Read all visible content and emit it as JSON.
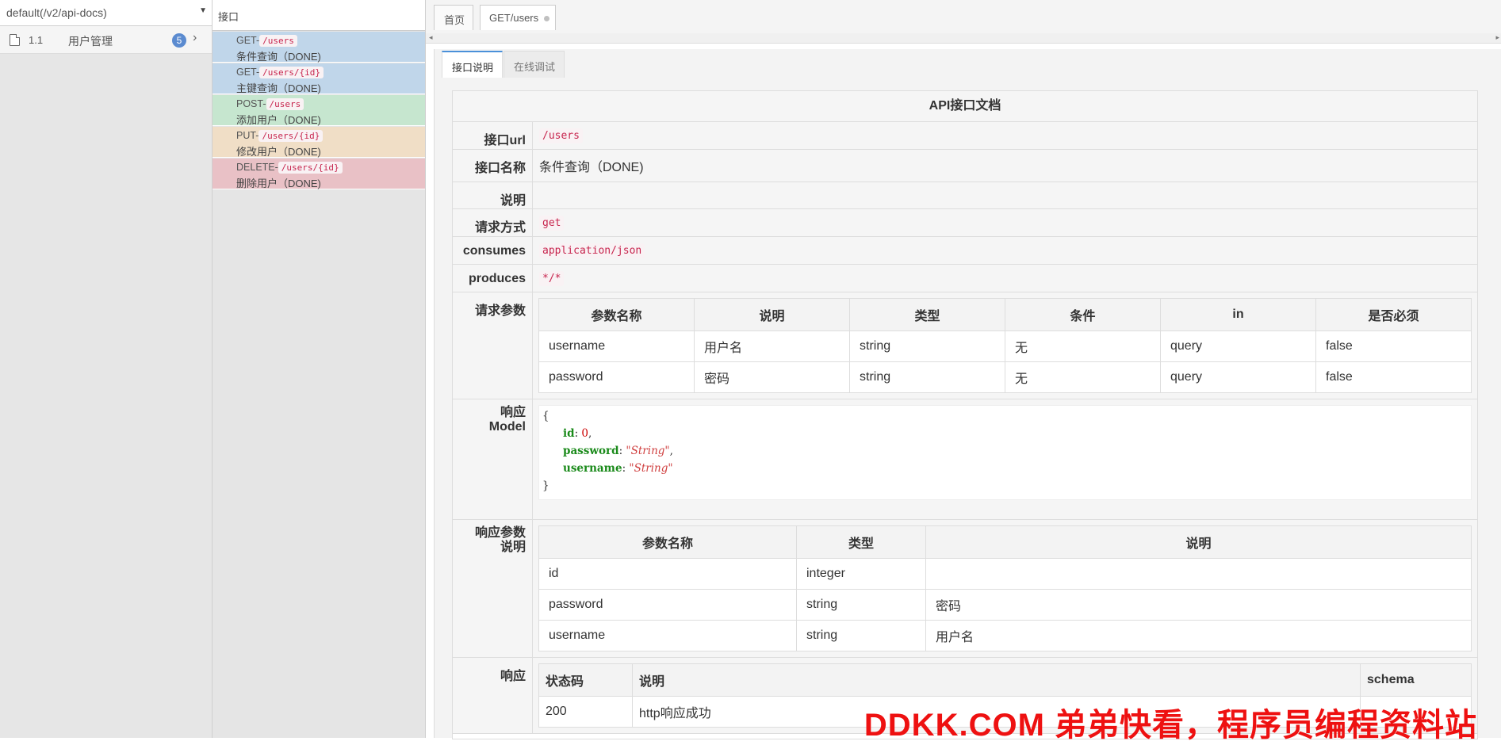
{
  "group_selector": {
    "value": "default(/v2/api-docs)"
  },
  "group": {
    "number": "1.1",
    "name": "用户管理",
    "count": "5"
  },
  "api_list": {
    "header": "接口",
    "items": [
      {
        "method": "GET-",
        "path": "/users",
        "name": "条件查询（DONE)"
      },
      {
        "method": "GET-",
        "path": "/users/{id}",
        "name": "主键查询（DONE)"
      },
      {
        "method": "POST-",
        "path": "/users",
        "name": "添加用户（DONE)"
      },
      {
        "method": "PUT-",
        "path": "/users/{id}",
        "name": "修改用户（DONE)"
      },
      {
        "method": "DELETE-",
        "path": "/users/{id}",
        "name": "删除用户（DONE)"
      }
    ]
  },
  "tabs": {
    "home": "首页",
    "active": "GET/users"
  },
  "subtabs": {
    "desc": "接口说明",
    "debug": "在线调试"
  },
  "doc": {
    "title": "API接口文档",
    "rows": {
      "url_label": "接口url",
      "url": "/users",
      "name_label": "接口名称",
      "name": "条件查询（DONE)",
      "desc_label": "说明",
      "desc": "",
      "method_label": "请求方式",
      "method": "get",
      "consumes_label": "consumes",
      "consumes": "application/json",
      "produces_label": "produces",
      "produces": "*/*",
      "params_label": "请求参数",
      "model_label_1": "响应",
      "model_label_2": "Model",
      "respparams_label_1": "响应参数",
      "respparams_label_2": "说明",
      "response_label": "响应"
    },
    "params_table": {
      "headers": [
        "参数名称",
        "说明",
        "类型",
        "条件",
        "in",
        "是否必须"
      ],
      "rows": [
        [
          "username",
          "用户名",
          "string",
          "无",
          "query",
          "false"
        ],
        [
          "password",
          "密码",
          "string",
          "无",
          "query",
          "false"
        ]
      ]
    },
    "model": {
      "open": "{",
      "close": "}",
      "fields": [
        {
          "key": "id",
          "value": "0",
          "sep": ","
        },
        {
          "key": "password",
          "value": "\"String\"",
          "sep": ","
        },
        {
          "key": "username",
          "value": "\"String\"",
          "sep": ""
        }
      ]
    },
    "resp_params_table": {
      "headers": [
        "参数名称",
        "类型",
        "说明"
      ],
      "rows": [
        [
          "id",
          "integer",
          ""
        ],
        [
          "password",
          "string",
          "密码"
        ],
        [
          "username",
          "string",
          "用户名"
        ]
      ]
    },
    "response_table": {
      "headers": [
        "状态码",
        "说明",
        "schema"
      ],
      "rows": [
        [
          "200",
          "http响应成功",
          ""
        ]
      ]
    }
  },
  "watermark": "DDKK.COM 弟弟快看，程序员编程资料站"
}
